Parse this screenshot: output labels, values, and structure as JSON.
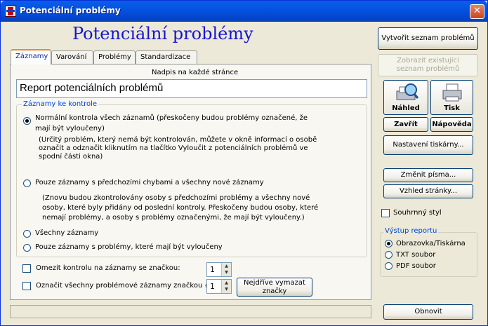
{
  "window": {
    "title": "Potenciální problémy"
  },
  "heading": "Potenciální problémy",
  "tabs": [
    "Záznamy",
    "Varování",
    "Problémy",
    "Standardizace"
  ],
  "header": {
    "label": "Nadpis na každé stránce",
    "value": "Report potenciálních problémů"
  },
  "records": {
    "legend": "Záznamy ke kontrole",
    "opt1": {
      "label": "Normální kontrola všech záznamů (přeskočeny budou problémy označené, že",
      "label2": "mají být vyloučeny)",
      "note1": "(Určitý problém, který nemá být kontrolován, můžete v okně informací o osobě",
      "note2": "označit a odznačit kliknutím na tlačítko Vyloučit z potenciálních problémů ve",
      "note3": "spodní části okna)"
    },
    "opt2": {
      "label": "Pouze záznamy s předchozími chybami a všechny nové záznamy",
      "note1": "(Znovu budou zkontrolovány osoby s předchozími problémy a všechny nové",
      "note2": "osoby, které byly přidány od poslední kontroly.  Přeskočeny budou osoby, které",
      "note3": "nemají problémy, a osoby s problémy označenými, že mají být vyloučeny.)"
    },
    "opt3": "Všechny záznamy",
    "opt4": "Pouze záznamy s problémy, které mají být vyloučeny"
  },
  "limit": {
    "label": "Omezit kontrolu na záznamy se značkou:",
    "value": "1"
  },
  "mark": {
    "label": "Označit všechny problémové záznamy značkou #:",
    "value": "1",
    "button": "Nejdříve vymazat značky"
  },
  "buttons": {
    "create": "Vytvořit seznam problémů",
    "show": "Zobrazit existující seznam problémů",
    "preview": "Náhled",
    "print": "Tisk",
    "close": "Zavřít",
    "help": "Nápověda",
    "printer": "Nastavení tiskárny...",
    "font": "Změnit písma...",
    "page": "Vzhled stránky...",
    "refresh": "Obnovit"
  },
  "summary_style": "Souhrnný styl",
  "output": {
    "legend": "Výstup reportu",
    "options": [
      "Obrazovka/Tiskárna",
      "TXT soubor",
      "PDF soubor"
    ],
    "selected": "Obrazovka/Tiskárna"
  },
  "icons": {
    "close": "close-icon",
    "preview": "magnifier-printer-icon",
    "print": "printer-icon",
    "app": "app-shield-icon"
  }
}
